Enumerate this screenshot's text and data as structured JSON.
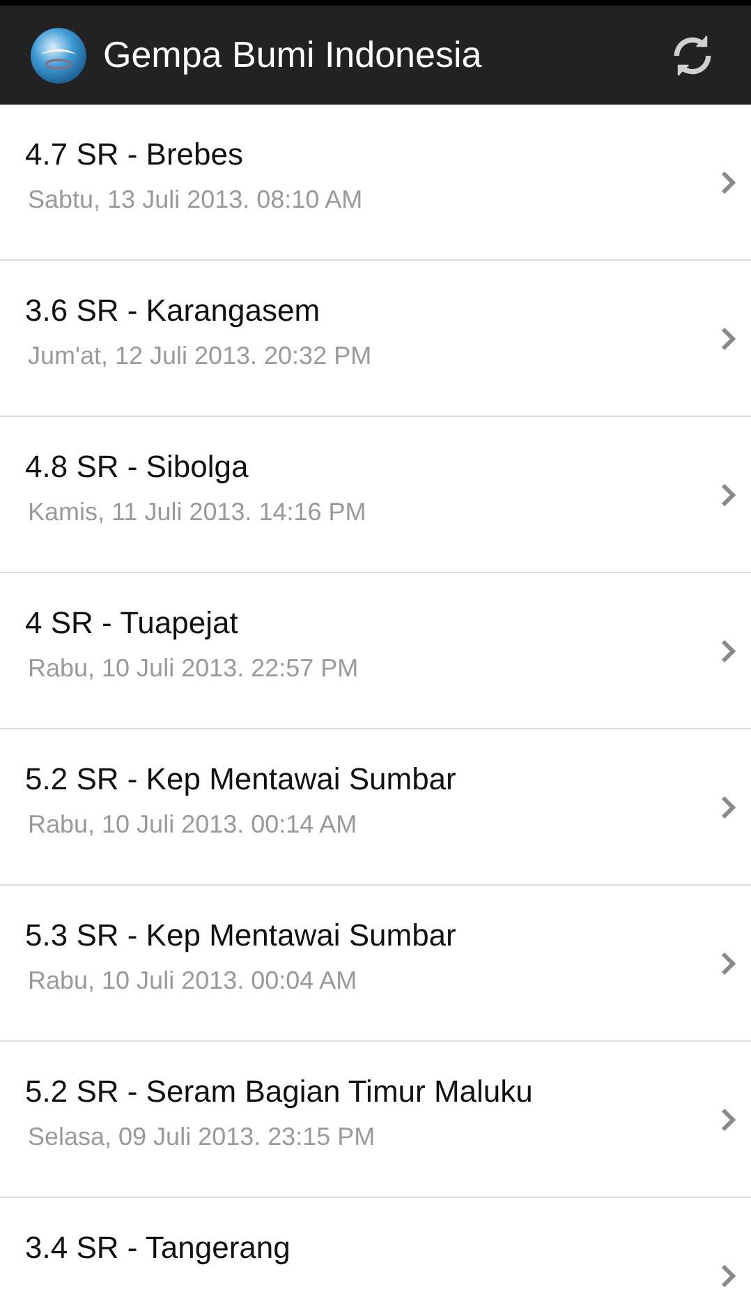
{
  "app_bar": {
    "title": "Gempa Bumi Indonesia"
  },
  "quakes": [
    {
      "title": "4.7 SR - Brebes",
      "date": "Sabtu, 13 Juli 2013. 08:10 AM"
    },
    {
      "title": "3.6 SR - Karangasem",
      "date": "Jum'at, 12 Juli 2013. 20:32 PM"
    },
    {
      "title": "4.8 SR - Sibolga",
      "date": "Kamis, 11 Juli 2013. 14:16 PM"
    },
    {
      "title": "4 SR - Tuapejat",
      "date": "Rabu, 10 Juli 2013. 22:57 PM"
    },
    {
      "title": "5.2 SR - Kep Mentawai Sumbar",
      "date": "Rabu, 10 Juli 2013. 00:14 AM"
    },
    {
      "title": "5.3 SR - Kep Mentawai Sumbar",
      "date": "Rabu, 10 Juli 2013. 00:04 AM"
    },
    {
      "title": "5.2 SR - Seram Bagian Timur Maluku",
      "date": "Selasa, 09 Juli 2013. 23:15 PM"
    },
    {
      "title": "3.4 SR - Tangerang"
    }
  ]
}
